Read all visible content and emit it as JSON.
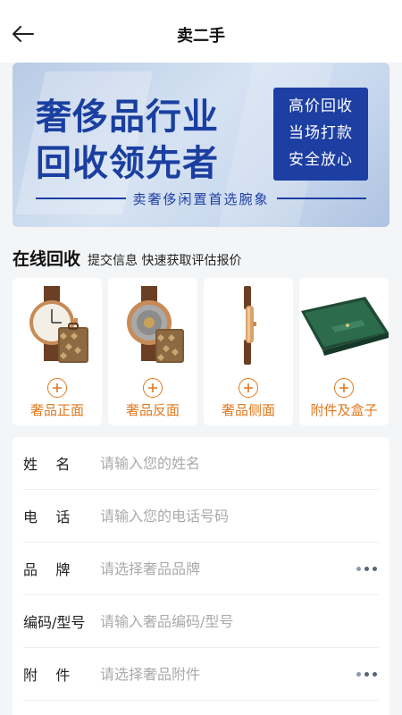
{
  "nav": {
    "title": "卖二手"
  },
  "banner": {
    "line1": "奢侈品行业",
    "line2": "回收领先者",
    "box_lines": [
      "高价回收",
      "当场打款",
      "安全放心"
    ],
    "tagline": "卖奢侈闲置首选腕象"
  },
  "section": {
    "title": "在线回收",
    "subtitle": "提交信息 快速获取评估报价"
  },
  "cards": [
    {
      "label": "奢品正面"
    },
    {
      "label": "奢品反面"
    },
    {
      "label": "奢品侧面"
    },
    {
      "label": "附件及盒子"
    }
  ],
  "form": {
    "fields": [
      {
        "label": "姓    名",
        "placeholder": "请输入您的姓名"
      },
      {
        "label": "电    话",
        "placeholder": "请输入您的电话号码"
      },
      {
        "label": "品    牌",
        "placeholder": "请选择奢品品牌"
      },
      {
        "label": "编码/型号",
        "placeholder": "请输入奢品编码/型号"
      },
      {
        "label": "附    件",
        "placeholder": "请选择奢品附件"
      }
    ]
  },
  "colors": {
    "accent": "#e0781f",
    "brand": "#1d3ea3"
  },
  "icons": {
    "back": "arrow-left-icon",
    "add": "plus-circle-icon",
    "more": "more-dots-icon"
  }
}
